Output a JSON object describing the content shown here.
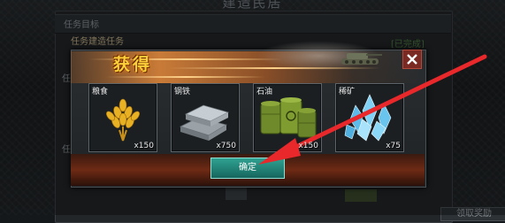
{
  "screen_title": "建造民居",
  "background_panel": {
    "header": "任务目标",
    "row_partial": "任务建造任务",
    "status": "[已完成]",
    "side_marker_1": "任",
    "side_marker_2": "任"
  },
  "popup": {
    "title": "获得",
    "confirm_label": "确定",
    "rewards": [
      {
        "name": "粮食",
        "quantity": "x150",
        "icon": "wheat-icon"
      },
      {
        "name": "钢铁",
        "quantity": "x750",
        "icon": "steel-ingot-icon"
      },
      {
        "name": "石油",
        "quantity": "x150",
        "icon": "oil-barrel-icon"
      },
      {
        "name": "稀矿",
        "quantity": "x75",
        "icon": "crystal-icon"
      }
    ]
  },
  "bottom_right_button": "领取奖励",
  "colors": {
    "title_gold": "#ffcf3a",
    "confirm_teal": "#2fa292",
    "close_red": "#7a2a22",
    "pointer_red": "#e8282a"
  }
}
